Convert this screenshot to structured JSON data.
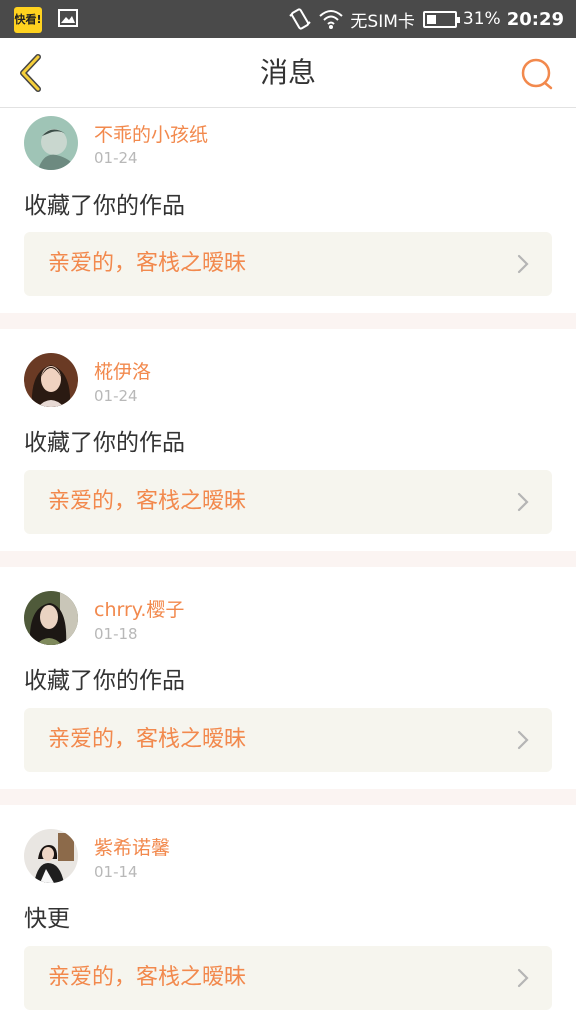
{
  "status_bar": {
    "app_badge": "快看!",
    "carrier": "无SIM卡",
    "battery": "31%",
    "battery_level": 0.31,
    "time": "20:29"
  },
  "header": {
    "title": "消息"
  },
  "colors": {
    "accent": "#f2894d",
    "link_bg": "#f6f5ee",
    "divider": "#fbf4f2"
  },
  "messages": [
    {
      "username": "不乖的小孩纸",
      "date": "01-24",
      "text": "收藏了你的作品",
      "work": "亲爱的，客栈之暧昧"
    },
    {
      "username": "椛伊洛",
      "date": "01-24",
      "text": "收藏了你的作品",
      "work": "亲爱的，客栈之暧昧"
    },
    {
      "username": "chrry.樱子",
      "date": "01-18",
      "text": "收藏了你的作品",
      "work": "亲爱的，客栈之暧昧"
    },
    {
      "username": "紫希诺馨",
      "date": "01-14",
      "text": "快更",
      "work": "亲爱的，客栈之暧昧"
    }
  ]
}
